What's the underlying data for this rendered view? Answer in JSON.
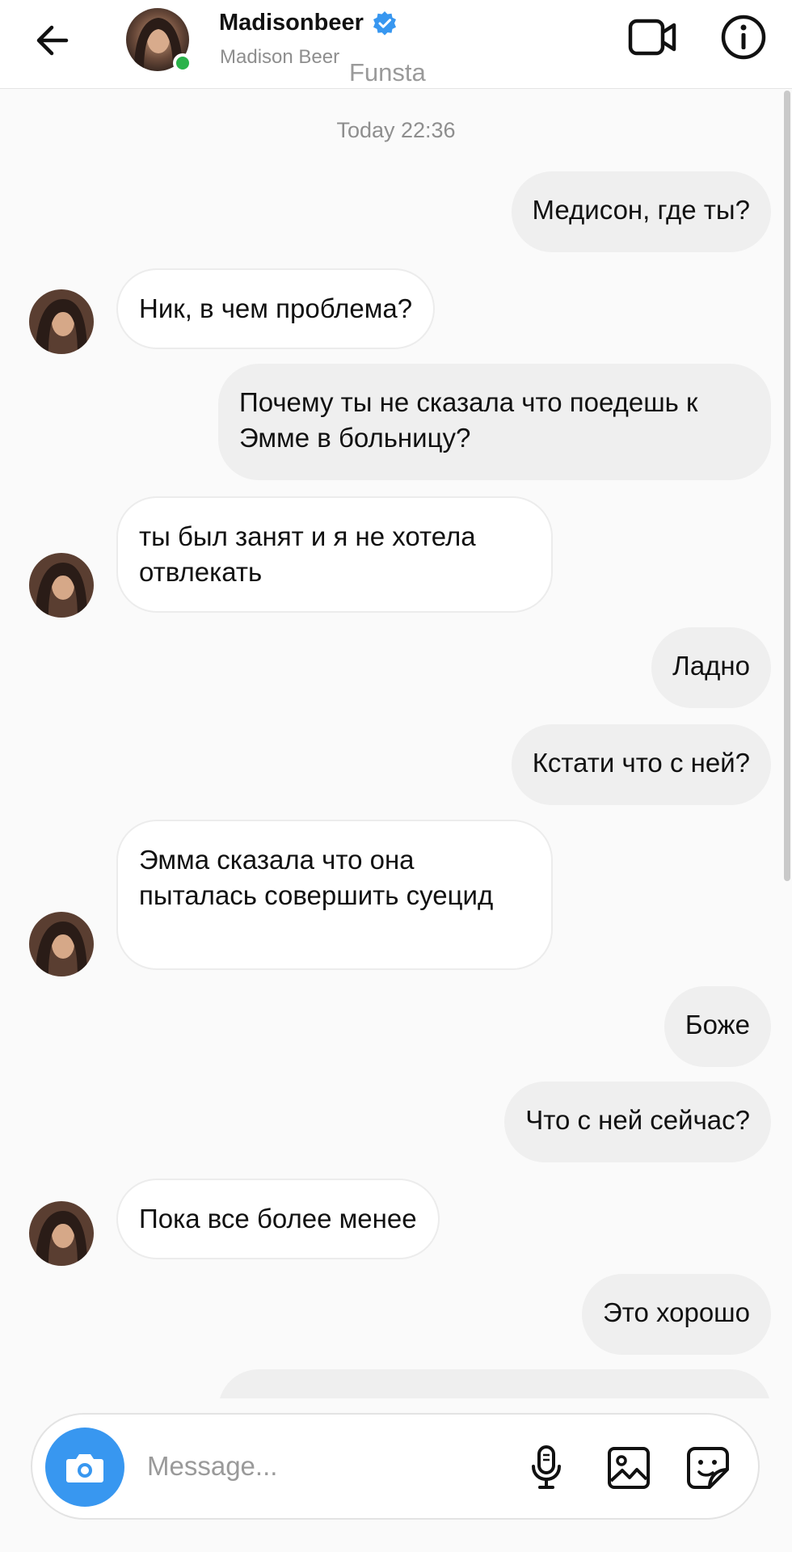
{
  "header": {
    "username": "Madisonbeer",
    "subname": "Madison Beer",
    "watermark": "Funsta"
  },
  "chat": {
    "timestamp": "Today 22:36",
    "messages": [
      {
        "side": "out",
        "text": "Медисон, где ты?"
      },
      {
        "side": "in",
        "text": "Ник, в чем проблема?"
      },
      {
        "side": "out",
        "text": "Почему ты не сказала что поедешь к Эмме в больницу?"
      },
      {
        "side": "in",
        "text": "ты был занят и я не хотела отвлекать"
      },
      {
        "side": "out",
        "text": "Ладно"
      },
      {
        "side": "out",
        "text": "Кстати что с ней?"
      },
      {
        "side": "in",
        "text": "Эмма сказала что она пыталась совершить суецид"
      },
      {
        "side": "out",
        "text": "Боже"
      },
      {
        "side": "out",
        "text": "Что с ней сейчас?"
      },
      {
        "side": "in",
        "text": "Пока все более менее"
      },
      {
        "side": "out",
        "text": "Это хорошо"
      }
    ]
  },
  "composer": {
    "placeholder": "Message..."
  },
  "colors": {
    "accent": "#3897f0",
    "online": "#2ab24a",
    "outgoing_bubble": "#efefef",
    "incoming_bubble": "#ffffff"
  },
  "icons": {
    "back": "arrow-left-icon",
    "verified": "verified-badge-icon",
    "video": "video-camera-icon",
    "info": "info-icon",
    "camera": "camera-icon",
    "mic": "microphone-icon",
    "gallery": "image-icon",
    "sticker": "sticker-icon"
  }
}
